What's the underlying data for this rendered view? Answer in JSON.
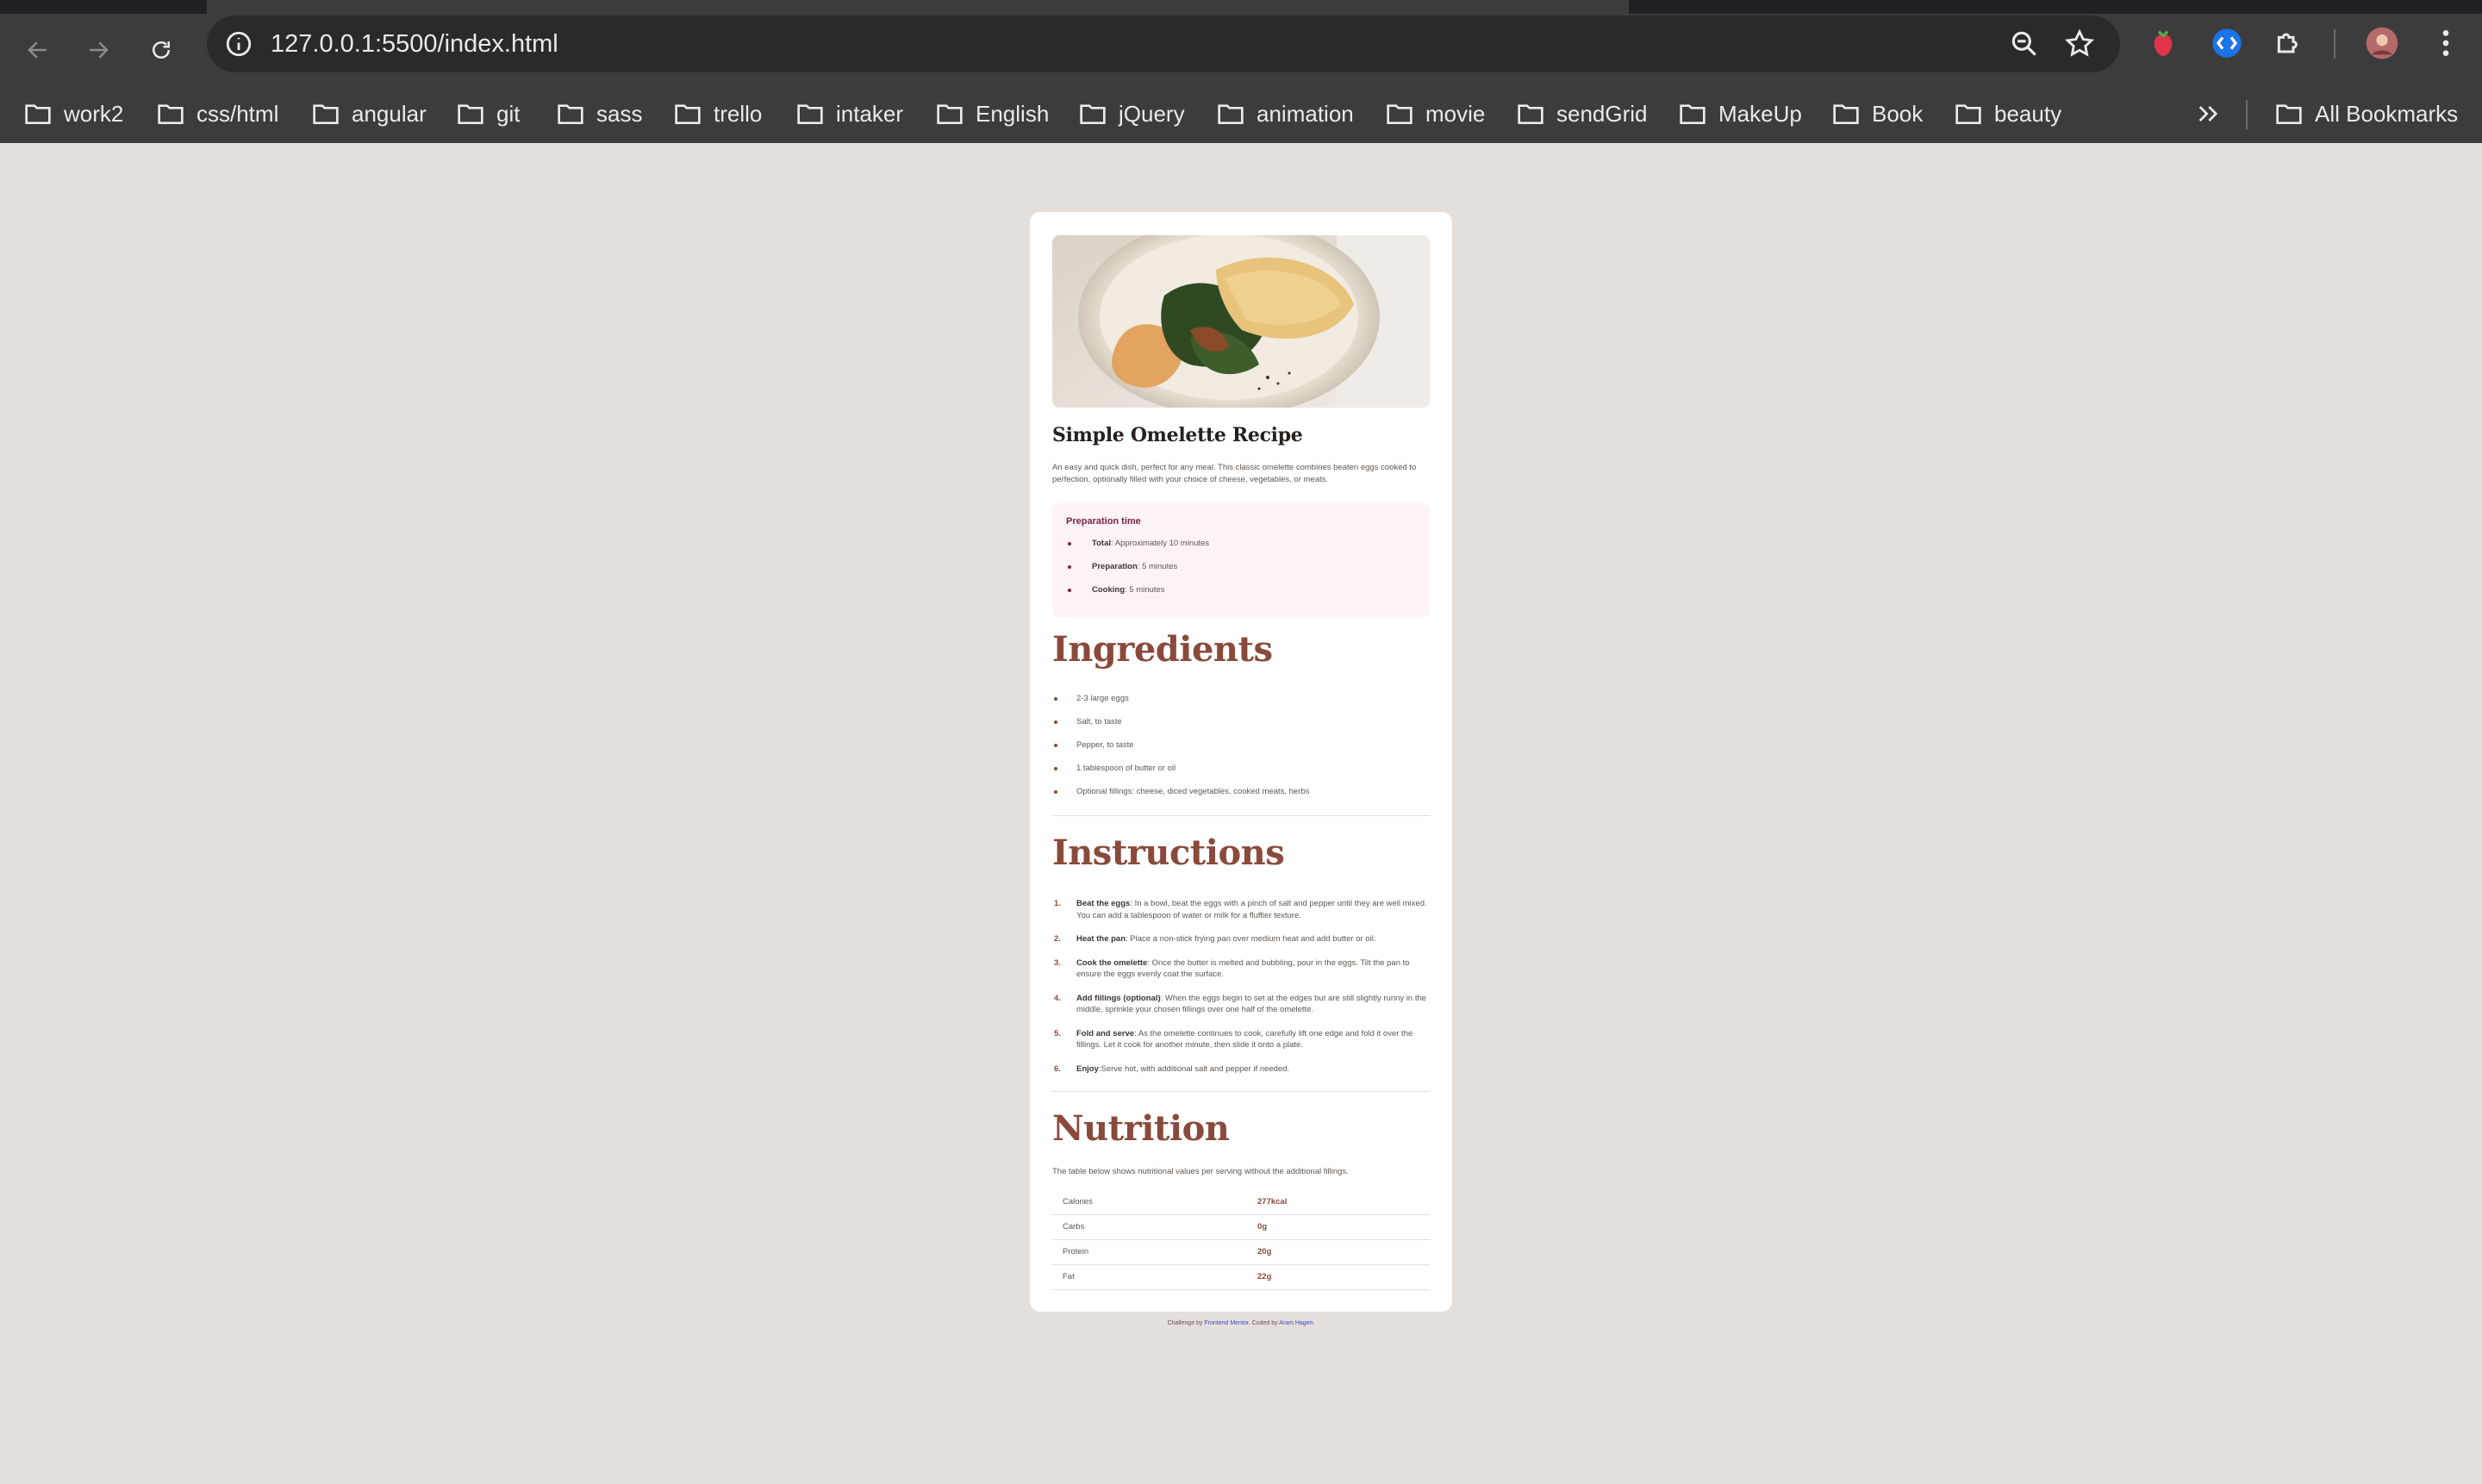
{
  "browser": {
    "url": "127.0.0.1:5500/index.html",
    "bookmarks": [
      "work2",
      "css/html",
      "angular",
      "git",
      "sass",
      "trello",
      "intaker",
      "English",
      "jQuery",
      "animation",
      "movie",
      "sendGrid",
      "MakeUp",
      "Book",
      "beauty"
    ],
    "all_bookmarks_label": "All Bookmarks",
    "icons": {
      "back": "arrow-left-icon",
      "forward": "arrow-right-icon",
      "reload": "reload-icon",
      "site_info": "info-icon",
      "zoom": "zoom-icon",
      "bookmark": "star-icon",
      "extension_1": "strawberry-extension-icon",
      "extension_2": "shazam-extension-icon",
      "extensions": "puzzle-icon",
      "profile": "avatar",
      "menu": "kebab-menu-icon",
      "overflow": "chevrons-right-icon"
    }
  },
  "recipe": {
    "title": "Simple Omelette Recipe",
    "intro": "An easy and quick dish, perfect for any meal. This classic omelette combines beaten eggs cooked to perfection, optionally filled with your choice of cheese, vegetables, or meats.",
    "prep": {
      "heading": "Preparation time",
      "items": [
        {
          "label": "Total",
          "value": ": Approximately 10 minutes"
        },
        {
          "label": "Preparation",
          "value": ": 5 minutes"
        },
        {
          "label": "Cooking",
          "value": ": 5 minutes"
        }
      ]
    },
    "ingredients": {
      "heading": "Ingredients",
      "items": [
        "2-3 large eggs",
        "Salt, to taste",
        "Pepper, to taste",
        "1 tablespoon of butter or oil",
        "Optional fillings: cheese, diced vegetables, cooked meats, herbs"
      ]
    },
    "instructions": {
      "heading": "Instructions",
      "items": [
        {
          "num": "1.",
          "label": "Beat the eggs",
          "text": ": In a bowl, beat the eggs with a pinch of salt and pepper until they are well mixed. You can add a tablespoon of water or milk for a fluffier texture."
        },
        {
          "num": "2.",
          "label": "Heat the pan",
          "text": ": Place a non-stick frying pan over medium heat and add butter or oil."
        },
        {
          "num": "3.",
          "label": "Cook the omelette",
          "text": ": Once the butter is melted and bubbling, pour in the eggs. Tilt the pan to ensure the eggs evenly coat the surface."
        },
        {
          "num": "4.",
          "label": "Add fillings (optional)",
          "text": ": When the eggs begin to set at the edges but are still slightly runny in the middle, sprinkle your chosen fillings over one half of the omelette."
        },
        {
          "num": "5.",
          "label": "Fold and serve",
          "text": ": As the omelette continues to cook, carefully lift one edge and fold it over the fillings. Let it cook for another minute, then slide it onto a plate."
        },
        {
          "num": "6.",
          "label": "Enjoy",
          "text": ":Serve hot, with additional salt and pepper if needed."
        }
      ]
    },
    "nutrition": {
      "heading": "Nutrition",
      "description": "The table below shows nutritional values per serving without the additional fillings.",
      "rows": [
        {
          "name": "Calories",
          "value": "277kcal"
        },
        {
          "name": "Carbs",
          "value": "0g"
        },
        {
          "name": "Protein",
          "value": "20g"
        },
        {
          "name": "Fat",
          "value": "22g"
        }
      ]
    },
    "attribution": {
      "prefix": "Challenge by ",
      "challenge_link": "Frontend Mentor",
      "middle": ". Coded by ",
      "author_link": "Aram Hagen",
      "suffix": "."
    }
  },
  "colors": {
    "page_bg": "#e4dfdb",
    "heading_brown": "#8a4a3b",
    "prep_accent": "#7b2446",
    "prep_bg": "#fcf3f6"
  }
}
